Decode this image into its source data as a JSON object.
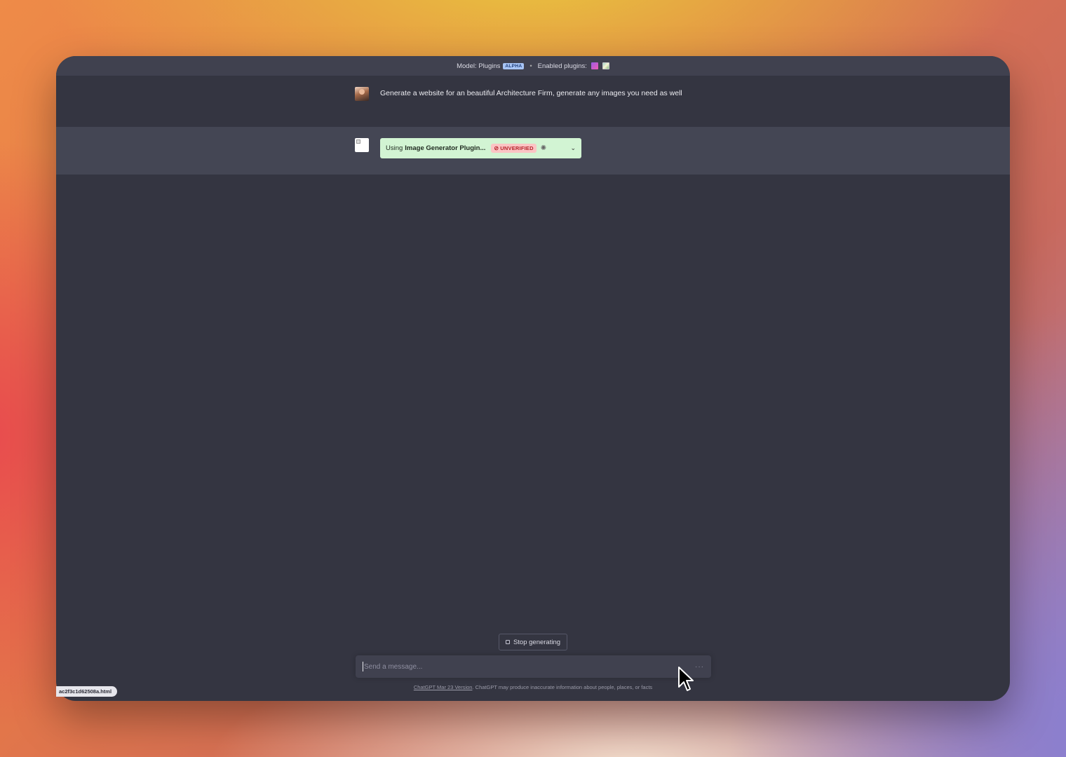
{
  "topbar": {
    "model_label": "Model: Plugins",
    "model_badge": "ALPHA",
    "separator": "•",
    "enabled_label": "Enabled plugins:"
  },
  "conversation": {
    "user_message": "Generate a website for an beautiful Architecture Firm, generate any images you need as well",
    "plugin_card": {
      "using_label": "Using",
      "plugin_name": "Image Generator Plugin...",
      "badge": "UNVERIFIED"
    }
  },
  "controls": {
    "stop_label": "Stop generating",
    "input_placeholder": "Send a message..."
  },
  "footer": {
    "version_link": "ChatGPT Mar 23 Version",
    "disclaimer": ". ChatGPT may produce inaccurate information about people, places, or facts"
  },
  "status_bar": {
    "url": "ac2f3c1d62508a.html"
  },
  "icons": {
    "plugin_1": "magic-wand-icon",
    "plugin_2": "image-icon",
    "unverified": "no-shield-icon",
    "spinner": "spinner-icon",
    "chevron": "chevron-down-icon",
    "more": "ellipsis-icon",
    "cursor": "mouse-cursor-icon"
  },
  "colors": {
    "window_bg": "#343541",
    "assistant_row_bg": "#444654",
    "plugin_card_bg": "#d2f4d3",
    "unverified_bg": "#fbc4c4",
    "unverified_text": "#b4232a"
  }
}
